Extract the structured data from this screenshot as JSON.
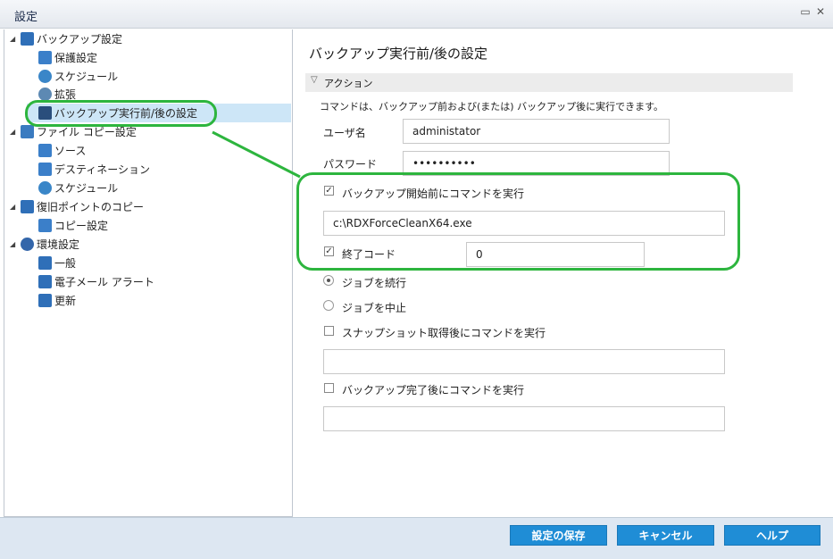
{
  "window": {
    "title": "設定"
  },
  "tree": {
    "backup_settings": "バックアップ設定",
    "protection": "保護設定",
    "schedule": "スケジュール",
    "advanced": "拡張",
    "pre_post": "バックアップ実行前/後の設定",
    "file_copy": "ファイル コピー設定",
    "source": "ソース",
    "destination": "デスティネーション",
    "file_copy_schedule": "スケジュール",
    "recovery_point_copy": "復旧ポイントのコピー",
    "copy_settings": "コピー設定",
    "preferences": "環境設定",
    "general": "一般",
    "email_alerts": "電子メール アラート",
    "updates": "更新"
  },
  "main": {
    "heading": "バックアップ実行前/後の設定",
    "section": "アクション",
    "description": "コマンドは、バックアップ前および(または) バックアップ後に実行できます。",
    "username_label": "ユーザ名",
    "username_value": "administator",
    "password_label": "パスワード",
    "password_value": "••••••••••",
    "pre_cmd_label": "バックアップ開始前にコマンドを実行",
    "pre_cmd_checked": true,
    "pre_cmd_value": "c:\\RDXForceCleanX64.exe",
    "exit_code_label": "終了コード",
    "exit_code_checked": true,
    "exit_code_value": "0",
    "radio_continue": "ジョブを続行",
    "radio_stop": "ジョブを中止",
    "snapshot_cmd_label": "スナップショット取得後にコマンドを実行",
    "snapshot_cmd_value": "",
    "post_cmd_label": "バックアップ完了後にコマンドを実行",
    "post_cmd_value": ""
  },
  "footer": {
    "save": "設定の保存",
    "cancel": "キャンセル",
    "help": "ヘルプ"
  },
  "icon_colors": {
    "blue": "#2f6fb8",
    "accent": "#1f8dd6",
    "highlight": "#2db53e"
  }
}
